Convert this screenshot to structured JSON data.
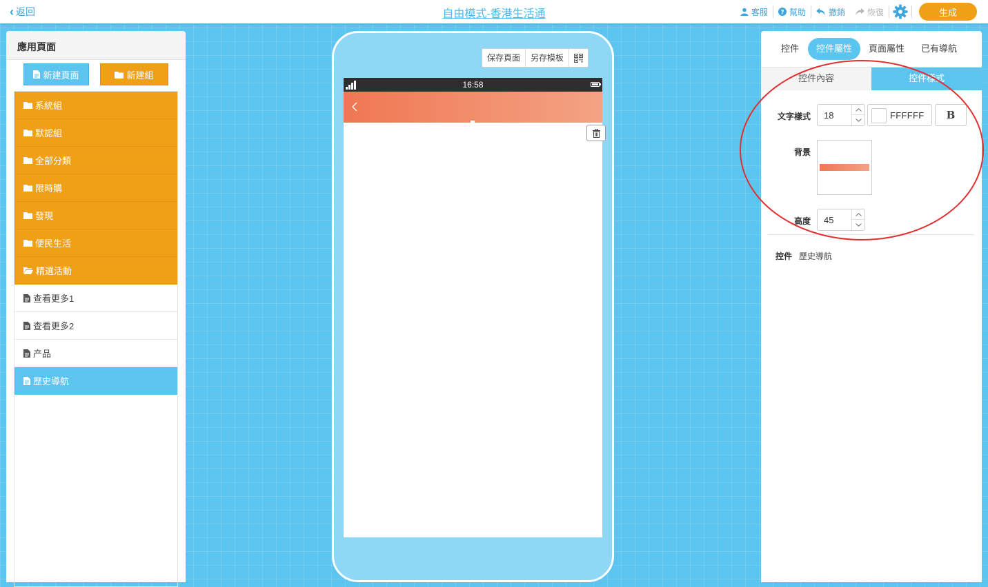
{
  "header": {
    "back_label": "返回",
    "title": "自由模式-香港生活通",
    "actions": {
      "service": "客服",
      "help": "幫助",
      "undo": "撤銷",
      "redo": "恢復",
      "generate": "生成"
    }
  },
  "left_panel": {
    "title": "應用頁面",
    "new_page_button": "新建頁面",
    "new_group_button": "新建組",
    "groups": [
      "系統組",
      "默認組",
      "全部分類",
      "限時購",
      "發現",
      "便民生活",
      "精選活動"
    ],
    "pages": [
      "查看更多1",
      "查看更多2",
      "产品",
      "歷史導航"
    ],
    "active_page": "歷史導航"
  },
  "phone": {
    "tools": {
      "save_page": "保存頁面",
      "save_template": "另存模板"
    },
    "status_time": "16:58",
    "navbar_gradient": [
      "#f07753",
      "#f3a384"
    ]
  },
  "right_panel": {
    "tabs": [
      "控件",
      "控件屬性",
      "頁面屬性",
      "已有導航"
    ],
    "active_tab": "控件屬性",
    "sub_tabs": [
      "控件內容",
      "控件樣式"
    ],
    "active_sub_tab": "控件樣式",
    "text_style_label": "文字樣式",
    "font_size": "18",
    "text_color": "FFFFFF",
    "bold_label": "B",
    "background_label": "背景",
    "background_gradient": [
      "#f07753",
      "#f3a384"
    ],
    "height_label": "高度",
    "height_value": "45",
    "control_key": "控件",
    "control_name": "歷史導航"
  },
  "colors": {
    "accent_blue": "#5bc5ef",
    "accent_orange": "#f0a016",
    "annotation_red": "#e03030"
  }
}
